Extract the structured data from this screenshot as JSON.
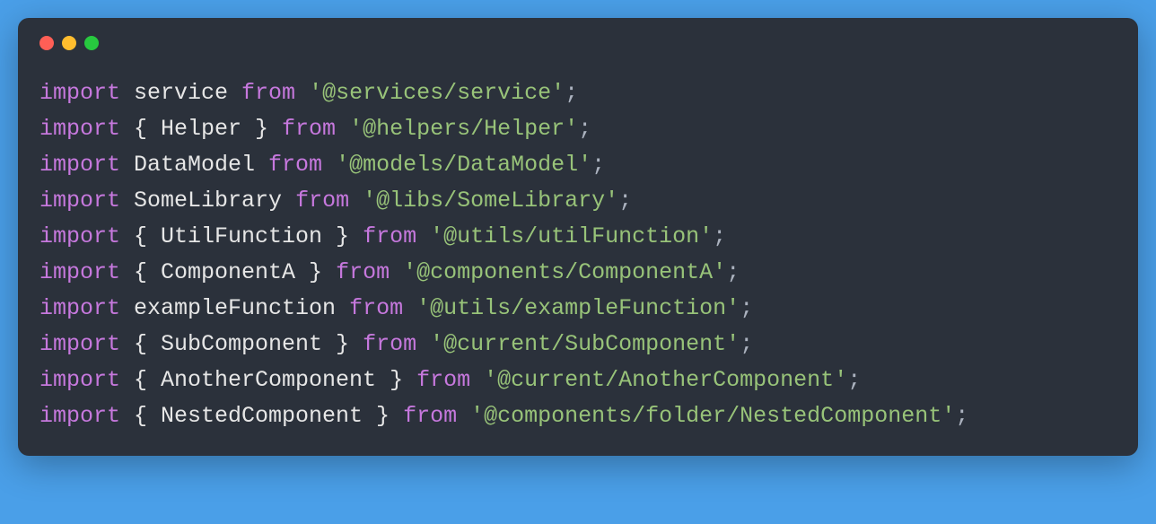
{
  "colors": {
    "background": "#4a9fe8",
    "window": "#2b313b",
    "keyword": "#c678dd",
    "string": "#98c379",
    "plain": "#e6e6e6",
    "punct": "#abb2bf",
    "red": "#ff5f56",
    "yellow": "#ffbd2e",
    "green": "#27c93f"
  },
  "lines": [
    {
      "import": "import",
      "ident": " service ",
      "from": "from",
      "sp": " ",
      "q1": "'",
      "path": "@services/service",
      "q2": "'",
      "semi": ";"
    },
    {
      "import": "import",
      "ident": " { Helper } ",
      "from": "from",
      "sp": " ",
      "q1": "'",
      "path": "@helpers/Helper",
      "q2": "'",
      "semi": ";"
    },
    {
      "import": "import",
      "ident": " DataModel ",
      "from": "from",
      "sp": " ",
      "q1": "'",
      "path": "@models/DataModel",
      "q2": "'",
      "semi": ";"
    },
    {
      "import": "import",
      "ident": " SomeLibrary ",
      "from": "from",
      "sp": " ",
      "q1": "'",
      "path": "@libs/SomeLibrary",
      "q2": "'",
      "semi": ";"
    },
    {
      "import": "import",
      "ident": " { UtilFunction } ",
      "from": "from",
      "sp": " ",
      "q1": "'",
      "path": "@utils/utilFunction",
      "q2": "'",
      "semi": ";"
    },
    {
      "import": "import",
      "ident": " { ComponentA } ",
      "from": "from",
      "sp": " ",
      "q1": "'",
      "path": "@components/ComponentA",
      "q2": "'",
      "semi": ";"
    },
    {
      "import": "import",
      "ident": " exampleFunction ",
      "from": "from",
      "sp": " ",
      "q1": "'",
      "path": "@utils/exampleFunction",
      "q2": "'",
      "semi": ";"
    },
    {
      "import": "import",
      "ident": " { SubComponent } ",
      "from": "from",
      "sp": " ",
      "q1": "'",
      "path": "@current/SubComponent",
      "q2": "'",
      "semi": ";"
    },
    {
      "import": "import",
      "ident": " { AnotherComponent } ",
      "from": "from",
      "sp": " ",
      "q1": "'",
      "path": "@current/AnotherComponent",
      "q2": "'",
      "semi": ";"
    },
    {
      "import": "import",
      "ident": " { NestedComponent } ",
      "from": "from",
      "sp": " ",
      "q1": "'",
      "path": "@components/folder/NestedComponent",
      "q2": "'",
      "semi": ";"
    }
  ]
}
